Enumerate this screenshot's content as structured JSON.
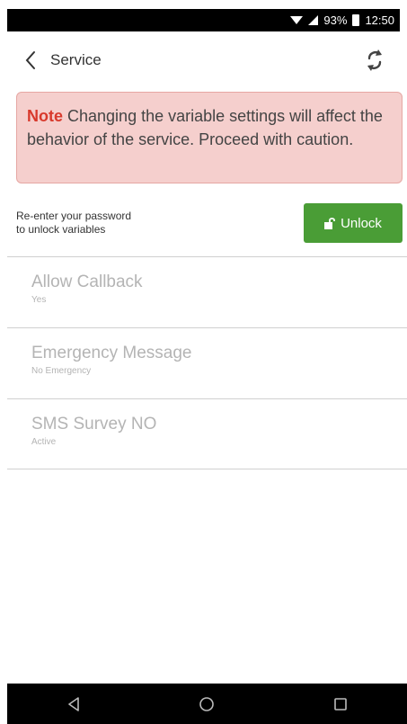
{
  "status_bar": {
    "battery": "93%",
    "time": "12:50"
  },
  "header": {
    "title": "Service"
  },
  "note": {
    "label": "Note",
    "text": "Changing the variable settings will affect the behavior of the service. Proceed with caution."
  },
  "unlock": {
    "prompt_line1": "Re-enter your password",
    "prompt_line2": "to unlock variables",
    "button_label": "Unlock"
  },
  "variables": [
    {
      "name": "Allow Callback",
      "value": "Yes"
    },
    {
      "name": "Emergency Message",
      "value": "No Emergency"
    },
    {
      "name": "SMS Survey NO",
      "value": "Active"
    }
  ],
  "colors": {
    "note_bg": "#f5cfcd",
    "note_label": "#d8392c",
    "unlock_button": "#4a9d36",
    "disabled_text": "#b4b4b4"
  },
  "icons": {
    "wifi": "wifi-icon",
    "signal": "signal-icon",
    "battery": "battery-icon",
    "back": "chevron-left-icon",
    "refresh": "refresh-icon",
    "lock": "unlock-icon",
    "nav_back": "triangle-back-icon",
    "nav_home": "circle-home-icon",
    "nav_recents": "square-recents-icon"
  }
}
